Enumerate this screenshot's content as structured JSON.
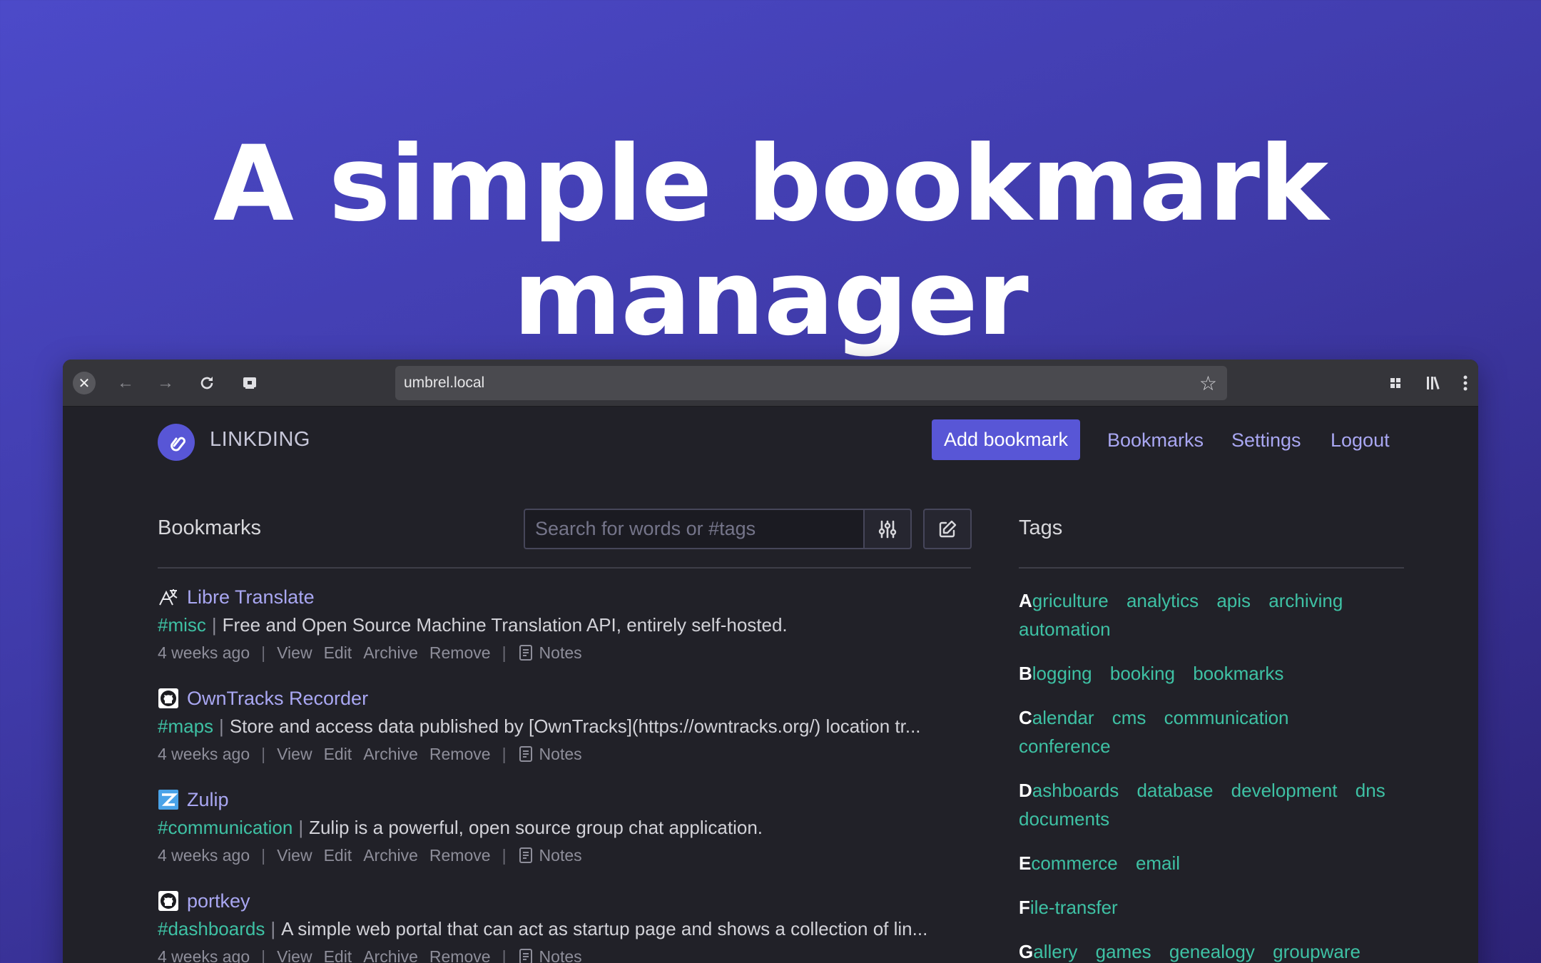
{
  "headline": "A simple bookmark manager",
  "browser": {
    "url": "umbrel.local",
    "buttons": [
      "close",
      "back",
      "forward",
      "reload",
      "screenshot",
      "bookmark-star",
      "extensions",
      "library",
      "menu"
    ]
  },
  "app": {
    "brand": "LINKDING",
    "nav": {
      "add_bookmark": "Add bookmark",
      "bookmarks": "Bookmarks",
      "settings": "Settings",
      "logout": "Logout"
    },
    "bookmarks_section": {
      "title": "Bookmarks",
      "search_placeholder": "Search for words or #tags"
    },
    "bookmarks": [
      {
        "title": "Libre Translate",
        "tag": "#misc",
        "description": "Free and Open Source Machine Translation API, entirely self-hosted.",
        "age": "4 weeks ago",
        "actions": [
          "View",
          "Edit",
          "Archive",
          "Remove"
        ],
        "notes": "Notes"
      },
      {
        "title": "OwnTracks Recorder",
        "tag": "#maps",
        "description": "Store and access data published by [OwnTracks](https://owntracks.org/) location tr...",
        "age": "4 weeks ago",
        "actions": [
          "View",
          "Edit",
          "Archive",
          "Remove"
        ],
        "notes": "Notes"
      },
      {
        "title": "Zulip",
        "tag": "#communication",
        "description": "Zulip is a powerful, open source group chat application.",
        "age": "4 weeks ago",
        "actions": [
          "View",
          "Edit",
          "Archive",
          "Remove"
        ],
        "notes": "Notes"
      },
      {
        "title": "portkey",
        "tag": "#dashboards",
        "description": "A simple web portal that can act as startup page and shows a collection of lin...",
        "age": "4 weeks ago",
        "actions": [
          "View",
          "Edit",
          "Archive",
          "Remove"
        ],
        "notes": "Notes"
      }
    ],
    "tags_section": {
      "title": "Tags",
      "groups": [
        {
          "first_letter": "A",
          "tags": [
            "griculture",
            "analytics",
            "apis",
            "archiving",
            "automation"
          ]
        },
        {
          "first_letter": "B",
          "tags": [
            "logging",
            "booking",
            "bookmarks"
          ]
        },
        {
          "first_letter": "C",
          "tags": [
            "alendar",
            "cms",
            "communication",
            "conference"
          ]
        },
        {
          "first_letter": "D",
          "tags": [
            "ashboards",
            "database",
            "development",
            "dns",
            "documents"
          ]
        },
        {
          "first_letter": "E",
          "tags": [
            "commerce",
            "email"
          ]
        },
        {
          "first_letter": "F",
          "tags": [
            "ile-transfer"
          ]
        },
        {
          "first_letter": "G",
          "tags": [
            "allery",
            "games",
            "genealogy",
            "groupware"
          ]
        }
      ]
    }
  },
  "colors": {
    "accent": "#5856d6",
    "link": "#a9a7f2",
    "tag": "#3ec1a4",
    "background": "#212128"
  }
}
